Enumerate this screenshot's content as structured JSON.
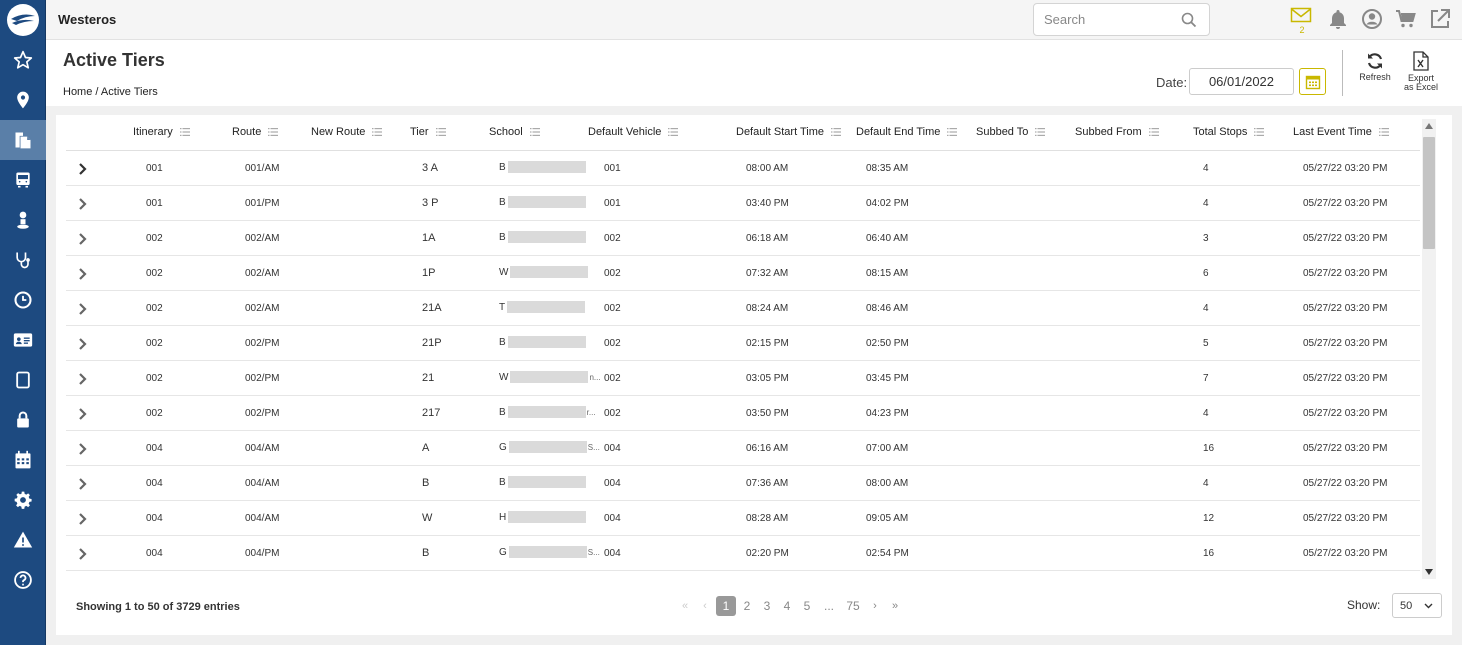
{
  "app": {
    "title": "Westeros"
  },
  "sidebar": {
    "items": [
      {
        "icon": "star-icon"
      },
      {
        "icon": "map-pin-icon"
      },
      {
        "icon": "documents-icon",
        "active": true
      },
      {
        "icon": "bus-icon"
      },
      {
        "icon": "person-icon"
      },
      {
        "icon": "stethoscope-icon"
      },
      {
        "icon": "clock-icon"
      },
      {
        "icon": "id-card-icon"
      },
      {
        "icon": "tablet-icon"
      },
      {
        "icon": "lock-icon"
      },
      {
        "icon": "calendar-icon"
      },
      {
        "icon": "gear-icon"
      },
      {
        "icon": "warning-icon"
      },
      {
        "icon": "help-icon"
      }
    ]
  },
  "topbar": {
    "search_placeholder": "Search",
    "mail_count": "2",
    "accent_color": "#c9b800"
  },
  "header": {
    "title": "Active Tiers",
    "breadcrumb_home": "Home",
    "breadcrumb_sep": "/",
    "breadcrumb_current": "Active Tiers",
    "date_label": "Date:",
    "date_value": "06/01/2022",
    "refresh_label": "Refresh",
    "export_label_1": "Export",
    "export_label_2": "as Excel"
  },
  "table": {
    "columns": [
      "Itinerary",
      "Route",
      "New Route",
      "Tier",
      "School",
      "Default Vehicle",
      "Default Start Time",
      "Default End Time",
      "Subbed To",
      "Subbed From",
      "Total Stops",
      "Last Event Time"
    ],
    "rows": [
      {
        "itinerary": "001",
        "route": "001/AM",
        "new_route": "",
        "tier": "3 A",
        "school_initial": "B",
        "school_tail": "",
        "vehicle": "001",
        "start": "08:00 AM",
        "end": "08:35 AM",
        "subbed_to": "",
        "subbed_from": "",
        "stops": "4",
        "last_event": "05/27/22 03:20 PM"
      },
      {
        "itinerary": "001",
        "route": "001/PM",
        "new_route": "",
        "tier": "3 P",
        "school_initial": "B",
        "school_tail": "",
        "vehicle": "001",
        "start": "03:40 PM",
        "end": "04:02 PM",
        "subbed_to": "",
        "subbed_from": "",
        "stops": "4",
        "last_event": "05/27/22 03:20 PM"
      },
      {
        "itinerary": "002",
        "route": "002/AM",
        "new_route": "",
        "tier": "1A",
        "school_initial": "B",
        "school_tail": "",
        "vehicle": "002",
        "start": "06:18 AM",
        "end": "06:40 AM",
        "subbed_to": "",
        "subbed_from": "",
        "stops": "3",
        "last_event": "05/27/22 03:20 PM"
      },
      {
        "itinerary": "002",
        "route": "002/AM",
        "new_route": "",
        "tier": "1P",
        "school_initial": "W",
        "school_tail": "",
        "vehicle": "002",
        "start": "07:32 AM",
        "end": "08:15 AM",
        "subbed_to": "",
        "subbed_from": "",
        "stops": "6",
        "last_event": "05/27/22 03:20 PM"
      },
      {
        "itinerary": "002",
        "route": "002/AM",
        "new_route": "",
        "tier": "21A",
        "school_initial": "T",
        "school_tail": "",
        "vehicle": "002",
        "start": "08:24 AM",
        "end": "08:46 AM",
        "subbed_to": "",
        "subbed_from": "",
        "stops": "4",
        "last_event": "05/27/22 03:20 PM"
      },
      {
        "itinerary": "002",
        "route": "002/PM",
        "new_route": "",
        "tier": "21P",
        "school_initial": "B",
        "school_tail": "",
        "vehicle": "002",
        "start": "02:15 PM",
        "end": "02:50 PM",
        "subbed_to": "",
        "subbed_from": "",
        "stops": "5",
        "last_event": "05/27/22 03:20 PM"
      },
      {
        "itinerary": "002",
        "route": "002/PM",
        "new_route": "",
        "tier": "21",
        "school_initial": "W",
        "school_tail": "n...",
        "vehicle": "002",
        "start": "03:05 PM",
        "end": "03:45 PM",
        "subbed_to": "",
        "subbed_from": "",
        "stops": "7",
        "last_event": "05/27/22 03:20 PM"
      },
      {
        "itinerary": "002",
        "route": "002/PM",
        "new_route": "",
        "tier": "217",
        "school_initial": "B",
        "school_tail": "r...",
        "vehicle": "002",
        "start": "03:50 PM",
        "end": "04:23 PM",
        "subbed_to": "",
        "subbed_from": "",
        "stops": "4",
        "last_event": "05/27/22 03:20 PM"
      },
      {
        "itinerary": "004",
        "route": "004/AM",
        "new_route": "",
        "tier": "A",
        "school_initial": "G",
        "school_tail": "S...",
        "vehicle": "004",
        "start": "06:16 AM",
        "end": "07:00 AM",
        "subbed_to": "",
        "subbed_from": "",
        "stops": "16",
        "last_event": "05/27/22 03:20 PM"
      },
      {
        "itinerary": "004",
        "route": "004/AM",
        "new_route": "",
        "tier": "B",
        "school_initial": "B",
        "school_tail": "",
        "vehicle": "004",
        "start": "07:36 AM",
        "end": "08:00 AM",
        "subbed_to": "",
        "subbed_from": "",
        "stops": "4",
        "last_event": "05/27/22 03:20 PM"
      },
      {
        "itinerary": "004",
        "route": "004/AM",
        "new_route": "",
        "tier": "W",
        "school_initial": "H",
        "school_tail": "",
        "vehicle": "004",
        "start": "08:28 AM",
        "end": "09:05 AM",
        "subbed_to": "",
        "subbed_from": "",
        "stops": "12",
        "last_event": "05/27/22 03:20 PM"
      },
      {
        "itinerary": "004",
        "route": "004/PM",
        "new_route": "",
        "tier": "B",
        "school_initial": "G",
        "school_tail": "S...",
        "vehicle": "004",
        "start": "02:20 PM",
        "end": "02:54 PM",
        "subbed_to": "",
        "subbed_from": "",
        "stops": "16",
        "last_event": "05/27/22 03:20 PM"
      }
    ]
  },
  "footer": {
    "info": "Showing 1 to 50 of 3729 entries",
    "pages": [
      "1",
      "2",
      "3",
      "4",
      "5"
    ],
    "ellipsis": "...",
    "last_page": "75",
    "first_glyph": "«",
    "prev_glyph": "‹",
    "next_glyph": "›",
    "last_glyph": "»",
    "show_label": "Show:",
    "show_value": "50"
  }
}
